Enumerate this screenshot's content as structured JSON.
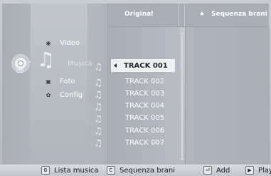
{
  "header": {
    "original_label": "Original",
    "star_glyph": "★",
    "sequence_label": "Sequenza brani"
  },
  "menu": {
    "items": [
      {
        "label": "Video",
        "icon": "video-icon"
      },
      {
        "label": "Musica",
        "icon": "music-icon"
      },
      {
        "label": "Foto",
        "icon": "photo-icon"
      },
      {
        "label": "Config",
        "icon": "settings-icon"
      }
    ]
  },
  "source": {
    "label": "CD",
    "icon": "cd-icon"
  },
  "tracks": [
    "TRACK 001",
    "TRACK 002",
    "TRACK 003",
    "TRACK 004",
    "TRACK 005",
    "TRACK 006",
    "TRACK 007"
  ],
  "selected_track_index": 0,
  "bottom_bar": {
    "buttons": [
      {
        "key": "B",
        "label": "Lista musica"
      },
      {
        "key": "C",
        "label": "Sequenza brani"
      },
      {
        "key": "⏎",
        "label": "Add"
      },
      {
        "key": "▶",
        "label": "Play"
      }
    ]
  },
  "colors": {
    "background": "#b8bcc3",
    "highlight": "#eef0f2",
    "text_light": "#ffffff",
    "text_dark": "#23272c"
  }
}
